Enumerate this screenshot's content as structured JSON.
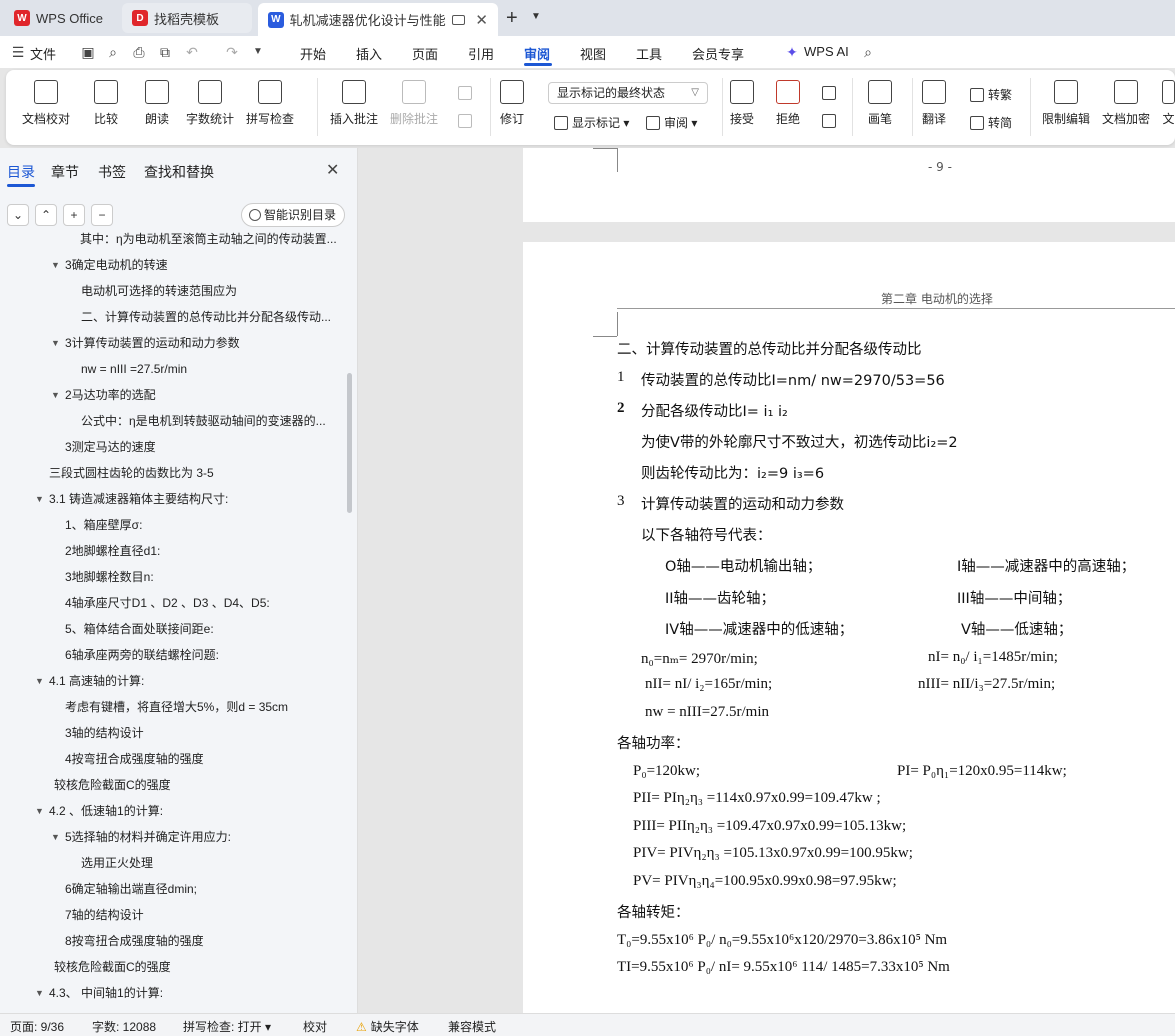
{
  "tabs": {
    "home": "WPS Office",
    "template": "找稻壳模板",
    "doc": "轧机减速器优化设计与性能分析"
  },
  "menu": [
    "文件",
    "开始",
    "插入",
    "页面",
    "引用",
    "审阅",
    "视图",
    "工具",
    "会员专享",
    "WPS AI"
  ],
  "ribbon": {
    "doc_proof": "文档校对",
    "compare": "比较",
    "read_aloud": "朗读",
    "word_count": "字数统计",
    "spell_check": "拼写检查",
    "insert_comment": "插入批注",
    "delete_comment": "删除批注",
    "revise": "修订",
    "mark_state": "显示标记的最终状态",
    "show_marks": "显示标记",
    "review": "审阅",
    "accept": "接受",
    "reject": "拒绝",
    "ink": "画笔",
    "translate": "翻译",
    "to_trad": "转繁",
    "to_simp": "转简",
    "restrict_edit": "限制编辑",
    "doc_encrypt": "文档加密",
    "more": "文"
  },
  "nav": {
    "tabs": [
      "目录",
      "章节",
      "书签",
      "查找和替换"
    ],
    "smart_toc": "智能识别目录",
    "toc": [
      {
        "text": "其中：η为电动机至滚筒主动轴之间的传动装置...",
        "indent": 80,
        "arrow": false
      },
      {
        "text": "3确定电动机的转速",
        "indent": 65,
        "arrow": true
      },
      {
        "text": "电动机可选择的转速范围应为",
        "indent": 81,
        "arrow": false
      },
      {
        "text": "二、计算传动装置的总传动比并分配各级传动...",
        "indent": 81,
        "arrow": false
      },
      {
        "text": "3计算传动装置的运动和动力参数",
        "indent": 65,
        "arrow": true
      },
      {
        "text": "nw = nIII =27.5r/min",
        "indent": 81,
        "arrow": false
      },
      {
        "text": "2马达功率的选配",
        "indent": 65,
        "arrow": true
      },
      {
        "text": "公式中：η是电机到转鼓驱动轴间的变速器的...",
        "indent": 81,
        "arrow": false
      },
      {
        "text": "3测定马达的速度",
        "indent": 65,
        "arrow": false
      },
      {
        "text": "三段式圆柱齿轮的齿数比为 3-5",
        "indent": 49,
        "arrow": false
      },
      {
        "text": "3.1 铸造减速器箱体主要结构尺寸:",
        "indent": 49,
        "arrow": true
      },
      {
        "text": "1、箱座壁厚σ:",
        "indent": 65,
        "arrow": false
      },
      {
        "text": "2地脚螺栓直径d1:",
        "indent": 65,
        "arrow": false
      },
      {
        "text": "3地脚螺栓数目n:",
        "indent": 65,
        "arrow": false
      },
      {
        "text": "4轴承座尺寸D1 、D2 、D3 、D4、D5:",
        "indent": 65,
        "arrow": false
      },
      {
        "text": "5、箱体结合面处联接间距e:",
        "indent": 65,
        "arrow": false
      },
      {
        "text": "6轴承座两旁的联结螺栓问题:",
        "indent": 65,
        "arrow": false
      },
      {
        "text": "4.1 高速轴的计算:",
        "indent": 49,
        "arrow": true
      },
      {
        "text": "考虑有键槽，将直径增大5%，则d = 35cm",
        "indent": 65,
        "arrow": false
      },
      {
        "text": "3轴的结构设计",
        "indent": 65,
        "arrow": false
      },
      {
        "text": "4按弯扭合成强度轴的强度",
        "indent": 65,
        "arrow": false
      },
      {
        "text": "较核危险截面C的强度",
        "indent": 54,
        "arrow": false
      },
      {
        "text": "4.2 、低速轴1的计算:",
        "indent": 49,
        "arrow": true
      },
      {
        "text": "5选择轴的材料并确定许用应力:",
        "indent": 65,
        "arrow": true
      },
      {
        "text": "选用正火处理",
        "indent": 81,
        "arrow": false
      },
      {
        "text": "6确定轴输出端直径dmin;",
        "indent": 65,
        "arrow": false
      },
      {
        "text": "7轴的结构设计",
        "indent": 65,
        "arrow": false
      },
      {
        "text": "8按弯扭合成强度轴的强度",
        "indent": 65,
        "arrow": false
      },
      {
        "text": "较核危险截面C的强度",
        "indent": 54,
        "arrow": false
      },
      {
        "text": "4.3、 中间轴1的计算:",
        "indent": 49,
        "arrow": true
      }
    ]
  },
  "doc": {
    "prev_page_num": "- 9 -",
    "header": "第二章 电动机的选择",
    "heading": "二、计算传动装置的总传动比并分配各级传动比",
    "l1_num": "1",
    "l1": "传动装置的总传动比I=nm/ nw=2970/53=56",
    "l2_num": "2",
    "l2": "分配各级传动比I= i₁ i₂",
    "l3": "为使V带的外轮廓尺寸不致过大，初选传动比i₂=2",
    "l4": "则齿轮传动比为：i₂=9     i₃=6",
    "l5_num": "3",
    "l5": "计算传动装置的运动和动力参数",
    "l6": "以下各轴符号代表：",
    "a0": "O轴——电动机输出轴；",
    "a1": "I轴——减速器中的高速轴；",
    "a2": "II轴——齿轮轴；",
    "a3": "III轴——中间轴；",
    "a4": "IV轴——减速器中的低速轴；",
    "a5": "V轴——低速轴；",
    "n1": "n₀=nₘ= 2970r/min;",
    "n2": "nI= n₀/ i₁=1485r/min;",
    "n3": "nII= nI/ i₂=165r/min;",
    "n4": "nIII= nII/i₃=27.5r/min;",
    "n5": "nw = nIII=27.5r/min",
    "power_title": "各轴功率：",
    "p1": "P₀=120kw;",
    "p2": "PI= P₀η₁=120x0.95=114kw;",
    "p3": "PII= PIη₂η₃ =114x0.97x0.99=109.47kw ;",
    "p4": "PIII= PIIη₂η₃ =109.47x0.97x0.99=105.13kw;",
    "p5": "PIV= PIVη₂η₃ =105.13x0.97x0.99=100.95kw;",
    "p6": "PV= PIVη₃η₄=100.95x0.99x0.98=97.95kw;",
    "torque_title": "各轴转矩：",
    "t1": "T₀=9.55x10⁶ P₀/ n₀=9.55x10⁶x120/2970=3.86x10⁵ Nm",
    "t2": "TI=9.55x10⁶ P₀/ nI= 9.55x10⁶ 114/ 1485=7.33x10⁵ Nm"
  },
  "status": {
    "page": "页面: 9/36",
    "words": "字数: 12088",
    "spell": "拼写检查: 打开",
    "proof": "校对",
    "missing_font": "缺失字体",
    "compat": "兼容模式"
  }
}
